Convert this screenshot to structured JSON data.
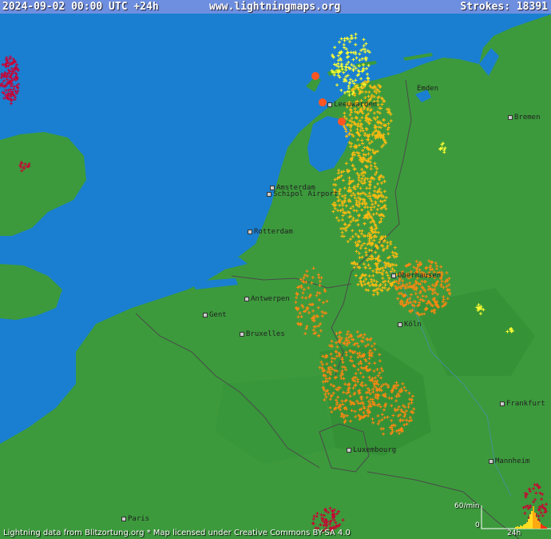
{
  "header": {
    "datetime": "2024-09-02 00:00 UTC +24h",
    "site": "www.lightningmaps.org",
    "strokes_label": "Strokes:",
    "strokes_count": "18391"
  },
  "cities": [
    {
      "name": "Emden",
      "dot": false
    },
    {
      "name": "Bremen",
      "dot": true
    },
    {
      "name": "Leeuwarden",
      "dot": true
    },
    {
      "name": "Amsterdam",
      "dot": true
    },
    {
      "name": "Schipol Airport",
      "dot": true
    },
    {
      "name": "Rotterdam",
      "dot": true
    },
    {
      "name": "Oberhausen",
      "dot": true
    },
    {
      "name": "Antwerpen",
      "dot": true
    },
    {
      "name": "Gent",
      "dot": true
    },
    {
      "name": "Bruxelles",
      "dot": true
    },
    {
      "name": "Köln",
      "dot": true
    },
    {
      "name": "Frankfurt",
      "dot": true
    },
    {
      "name": "Luxembourg",
      "dot": true
    },
    {
      "name": "Mannheim",
      "dot": true
    },
    {
      "name": "Paris",
      "dot": true
    }
  ],
  "footer": {
    "credit": "Lightning data from Blitzortung.org  *  Map licensed under Creative Commons BY-SA 4.0",
    "hist_rate": "60/min",
    "hist_zero": "0",
    "hist_span": "24h"
  },
  "colors": {
    "sea": "#1a7fd0",
    "land": "#3c9a3c",
    "header_bar": "#6e8fe0",
    "strike_recent": "#ffff33",
    "strike_mid": "#ffbb11",
    "strike_older": "#ff8811",
    "strike_old": "#cc0033"
  }
}
